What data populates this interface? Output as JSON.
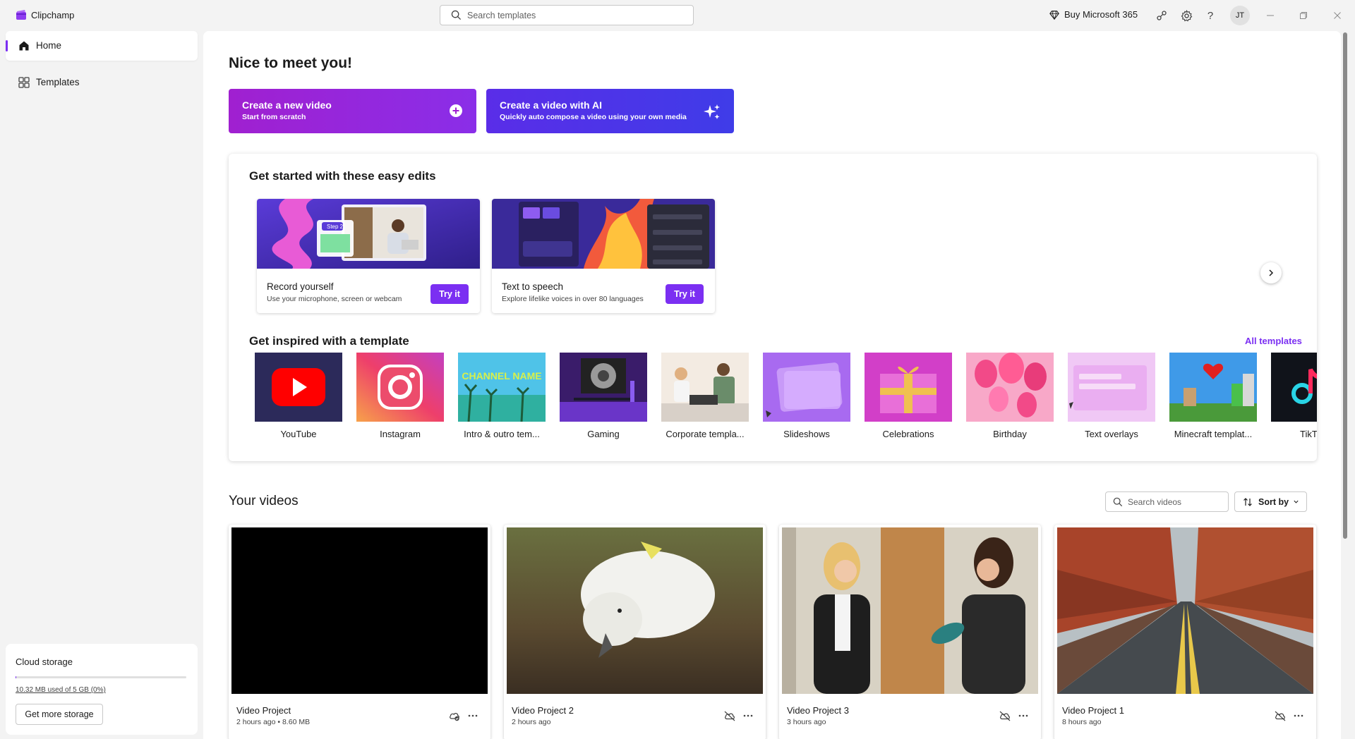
{
  "app": {
    "name": "Clipchamp"
  },
  "titlebar": {
    "search_placeholder": "Search templates",
    "buy_label": "Buy Microsoft 365",
    "avatar_initials": "JT",
    "icons": [
      "share-icon",
      "gear-icon",
      "help-icon"
    ],
    "window_controls": [
      "minimize-icon",
      "restore-icon",
      "close-icon"
    ]
  },
  "sidebar": {
    "items": [
      {
        "label": "Home",
        "icon": "home-icon",
        "active": true
      },
      {
        "label": "Templates",
        "icon": "templates-icon",
        "active": false
      }
    ],
    "storage": {
      "title": "Cloud storage",
      "usage": "10.32 MB used of 5 GB (0%)",
      "fraction": 0.002,
      "button": "Get more storage"
    }
  },
  "main": {
    "greeting": "Nice to meet you!",
    "create_new": {
      "title": "Create a new video",
      "subtitle": "Start from scratch"
    },
    "create_ai": {
      "title": "Create a video with AI",
      "subtitle": "Quickly auto compose a video using your own media"
    },
    "easy_edits": {
      "title": "Get started with these easy edits",
      "cards": [
        {
          "title": "Record yourself",
          "desc": "Use your microphone, screen or webcam",
          "button": "Try it",
          "thumb_label": "Step 2"
        },
        {
          "title": "Text to speech",
          "desc": "Explore lifelike voices in over 80 languages",
          "button": "Try it"
        }
      ]
    },
    "templates_section": {
      "title": "Get inspired with a template",
      "all_link": "All templates",
      "items": [
        {
          "label": "YouTube"
        },
        {
          "label": "Instagram"
        },
        {
          "label": "Intro & outro tem..."
        },
        {
          "label": "Gaming"
        },
        {
          "label": "Corporate templa..."
        },
        {
          "label": "Slideshows"
        },
        {
          "label": "Celebrations"
        },
        {
          "label": "Birthday"
        },
        {
          "label": "Text overlays"
        },
        {
          "label": "Minecraft templat..."
        },
        {
          "label": "TikT"
        }
      ],
      "intro_thumb_text": "CHANNEL NAME"
    },
    "your_videos": {
      "title": "Your videos",
      "search_placeholder": "Search videos",
      "sort_label": "Sort by",
      "videos": [
        {
          "title": "Video Project",
          "meta": "2 hours ago • 8.60 MB",
          "cloud_icon": "cloud-sync-icon"
        },
        {
          "title": "Video Project 2",
          "meta": "2 hours ago",
          "cloud_icon": "cloud-off-icon"
        },
        {
          "title": "Video Project 3",
          "meta": "3 hours ago",
          "cloud_icon": "cloud-off-icon"
        },
        {
          "title": "Video Project 1",
          "meta": "8 hours ago",
          "cloud_icon": "cloud-off-icon"
        }
      ]
    }
  },
  "colors": {
    "accent": "#7b2ff2",
    "new_video": "#a020d0",
    "ai_video": "#4a35e8"
  }
}
